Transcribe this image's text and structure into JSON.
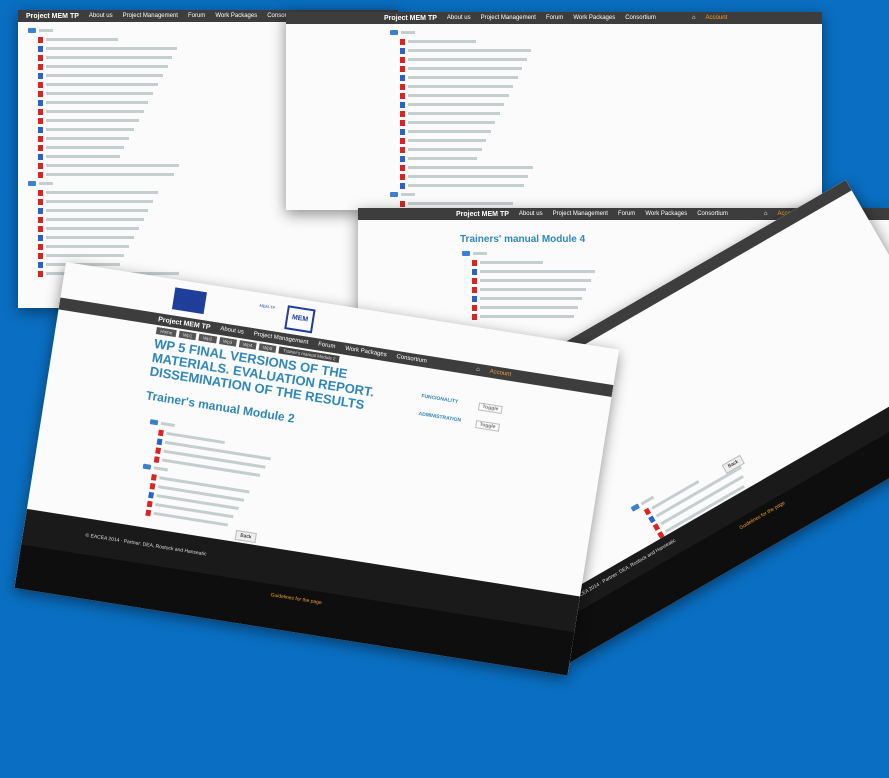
{
  "brand": "Project MEM TP",
  "nav": [
    "About us",
    "Project Management",
    "Forum",
    "Work Packages",
    "Consortium"
  ],
  "user_label": "Account",
  "wp_title": "WP 5 FINAL VERSIONS OF THE MATERIALS. EVALUATION REPORT. DISSEMINATION OF THE RESULTS",
  "module2_title": "Trainer's manual Module 2",
  "module4_title": "Trainers' manual Module 4",
  "side_links": [
    "FUNCIONALITY",
    "ADMINISTRATION"
  ],
  "side_badges": [
    "Toggle",
    "Toggle"
  ],
  "tabs": [
    "Home",
    "Wp1",
    "Wp2",
    "Wp3",
    "Wp4",
    "Wp5",
    "Trainer's manual Module 2"
  ],
  "folder_label": "Back",
  "back_button": "Back",
  "footer_text": "© EACEA 2014 · Partner: DEA, Rostock and Hanseatic",
  "footer_link": "Guidelines for the page",
  "logo_box": "MEM",
  "logo_text": "MEM-TP"
}
